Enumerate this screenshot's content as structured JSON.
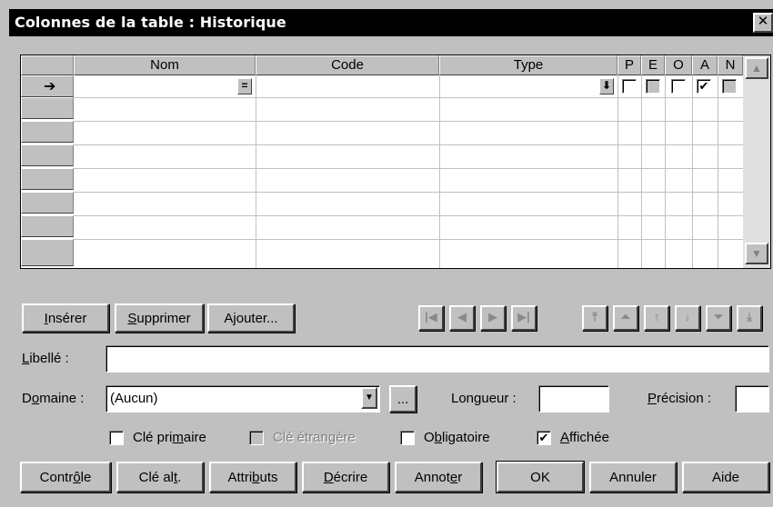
{
  "window": {
    "title": "Colonnes de la table : Historique",
    "close_glyph": "✕"
  },
  "grid": {
    "columns": [
      {
        "label": "Nom"
      },
      {
        "label": "Code"
      },
      {
        "label": "Type"
      },
      {
        "label": "P"
      },
      {
        "label": "E"
      },
      {
        "label": "O"
      },
      {
        "label": "A"
      },
      {
        "label": "N"
      }
    ],
    "current_row_marker": "➔",
    "first_row": {
      "nom": "",
      "code": "",
      "type": "",
      "flags": {
        "P": false,
        "E": false,
        "O": false,
        "A": true,
        "N": false
      }
    },
    "row_count": 8,
    "name_button_glyph": "=",
    "type_button_glyph": "⬇"
  },
  "buttons_row1": {
    "inserer": {
      "pre": "",
      "u": "I",
      "post": "nsérer"
    },
    "supprimer": {
      "pre": "",
      "u": "S",
      "post": "upprimer"
    },
    "ajouter": {
      "pre": "",
      "u": "",
      "post": "Ajouter..."
    }
  },
  "nav_buttons": [
    {
      "icon": "first-record-icon",
      "glyph": "|◀"
    },
    {
      "icon": "previous-record-icon",
      "glyph": "◀"
    },
    {
      "icon": "next-record-icon",
      "glyph": "▶"
    },
    {
      "icon": "last-record-icon",
      "glyph": "▶|"
    }
  ],
  "move_buttons": [
    {
      "icon": "move-top-icon",
      "glyph": "⤒"
    },
    {
      "icon": "move-page-up-icon",
      "glyph": "⏶"
    },
    {
      "icon": "move-up-icon",
      "glyph": "↑"
    },
    {
      "icon": "move-down-icon",
      "glyph": "↓"
    },
    {
      "icon": "move-page-down-icon",
      "glyph": "⏷"
    },
    {
      "icon": "move-bottom-icon",
      "glyph": "⤓"
    }
  ],
  "fields": {
    "libelle": {
      "label_u": "L",
      "label_post": "ibellé :",
      "value": ""
    },
    "domaine": {
      "label_pre": "D",
      "label_u": "o",
      "label_post": "maine :",
      "value": "(Aucun)"
    },
    "ellipsis": "...",
    "longueur": {
      "label": "Longueur :",
      "value": ""
    },
    "precision": {
      "label_u": "P",
      "label_post": "récision :",
      "value": ""
    }
  },
  "checkboxes": {
    "cle_primaire": {
      "pre": "Clé pri",
      "u": "m",
      "post": "aire",
      "checked": false,
      "disabled": false
    },
    "cle_etrangere": {
      "pre": "Clé étran",
      "u": "g",
      "post": "ère",
      "checked": false,
      "disabled": true
    },
    "obligatoire": {
      "pre": "O",
      "u": "b",
      "post": "ligatoire",
      "checked": false,
      "disabled": false
    },
    "affichee": {
      "pre": "",
      "u": "A",
      "post": "ffichée",
      "checked": true,
      "disabled": false
    }
  },
  "check_glyph": "✔",
  "buttons_bottom": {
    "controle": {
      "pre": "Contr",
      "u": "ô",
      "post": "le"
    },
    "cle_alt": {
      "pre": "Clé al",
      "u": "t",
      "post": "."
    },
    "attributs": {
      "pre": "Attri",
      "u": "b",
      "post": "uts"
    },
    "decrire": {
      "pre": "",
      "u": "D",
      "post": "écrire"
    },
    "annoter": {
      "pre": "Annot",
      "u": "e",
      "post": "r"
    },
    "ok": "OK",
    "annuler": "Annuler",
    "aide": "Aide"
  }
}
